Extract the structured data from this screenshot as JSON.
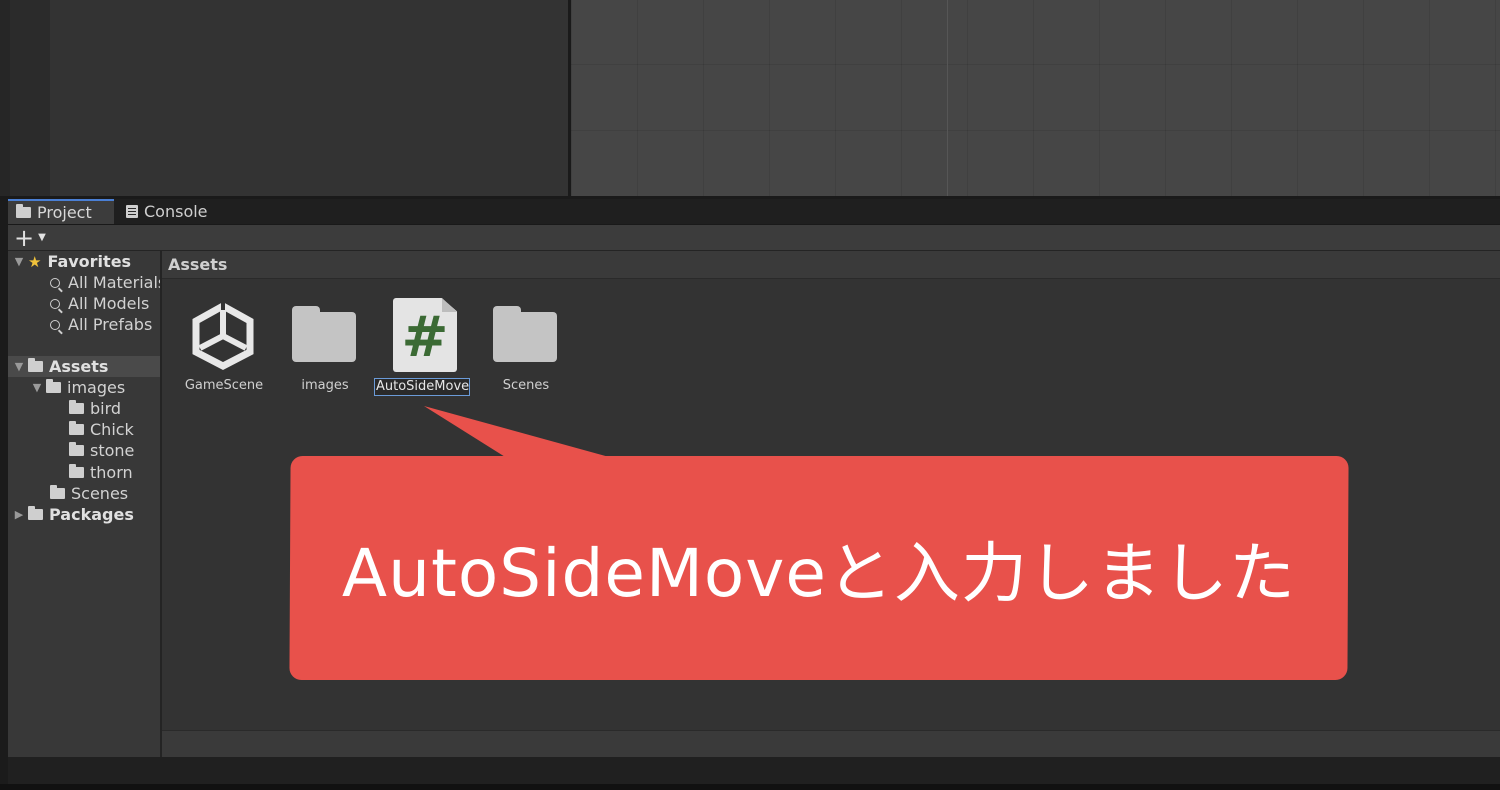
{
  "tabs": [
    {
      "label": "Project",
      "icon": "folder-icon",
      "active": true
    },
    {
      "label": "Console",
      "icon": "console-icon",
      "active": false
    }
  ],
  "toolbar": {
    "create_label": "+",
    "create_icon": "plus-icon",
    "dropdown_icon": "caret-down-icon"
  },
  "tree": {
    "favorites": {
      "label": "Favorites",
      "items": [
        "All Materials",
        "All Models",
        "All Prefabs"
      ]
    },
    "assets": {
      "label": "Assets",
      "images": {
        "label": "images",
        "children": [
          "bird",
          "Chick",
          "stone",
          "thorn"
        ]
      },
      "scenes": "Scenes"
    },
    "packages": "Packages"
  },
  "breadcrumb": {
    "label": "Assets"
  },
  "assets_grid": [
    {
      "label": "GameScene",
      "icon": "unity-scene-icon"
    },
    {
      "label": "images",
      "icon": "folder-icon"
    },
    {
      "label": "AutoSideMove",
      "icon": "csharp-script-icon",
      "renaming": true
    },
    {
      "label": "Scenes",
      "icon": "folder-icon"
    }
  ],
  "callout": {
    "text": "AutoSideMoveと入力しました",
    "color": "#e8514b"
  },
  "colors": {
    "tab_accent": "#4a7fd4",
    "rename_border": "#6b9bd8",
    "star": "#f0c23b",
    "hash": "#3b6a34"
  }
}
